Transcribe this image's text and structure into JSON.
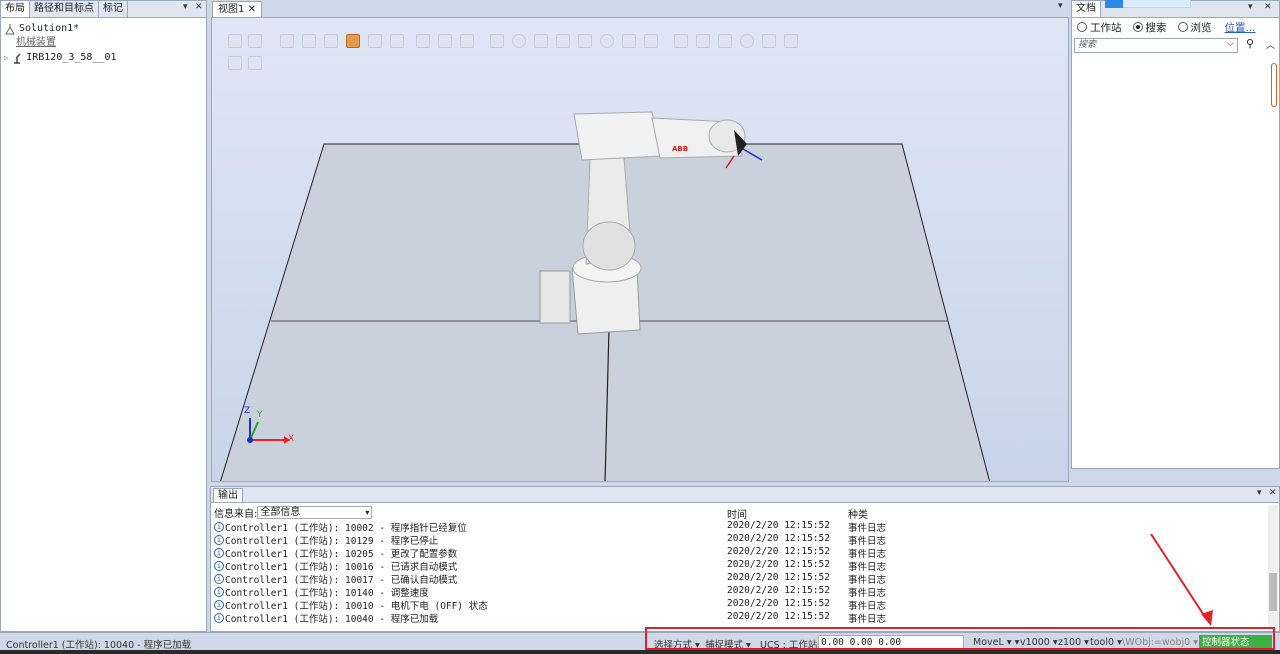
{
  "left_panel": {
    "tabs": [
      "布局",
      "路径和目标点",
      "标记"
    ],
    "tree": {
      "root": "Solution1*",
      "group": "机械装置",
      "item": "IRB120_3_58__01"
    }
  },
  "view": {
    "tab": "视图1",
    "robot_logo": "ABB",
    "axes": {
      "x": "X",
      "y": "Y",
      "z": "Z"
    }
  },
  "right_panel": {
    "tab": "文档",
    "radios": [
      {
        "label": "工作站",
        "selected": false
      },
      {
        "label": "搜索",
        "selected": true
      },
      {
        "label": "浏览",
        "selected": false
      }
    ],
    "location_link": "位置...",
    "search_placeholder": "搜索"
  },
  "output": {
    "tab": "输出",
    "filter_label": "信息来自:",
    "filter_value": "全部信息",
    "columns": {
      "time": "时间",
      "kind": "种类"
    },
    "rows": [
      {
        "msg": "Controller1 (工作站): 10002 - 程序指针已经复位",
        "time": "2020/2/20 12:15:52",
        "kind": "事件日志"
      },
      {
        "msg": "Controller1 (工作站): 10129 - 程序已停止",
        "time": "2020/2/20 12:15:52",
        "kind": "事件日志"
      },
      {
        "msg": "Controller1 (工作站): 10205 - 更改了配置参数",
        "time": "2020/2/20 12:15:52",
        "kind": "事件日志"
      },
      {
        "msg": "Controller1 (工作站): 10016 - 已请求自动模式",
        "time": "2020/2/20 12:15:52",
        "kind": "事件日志"
      },
      {
        "msg": "Controller1 (工作站): 10017 - 已确认自动模式",
        "time": "2020/2/20 12:15:52",
        "kind": "事件日志"
      },
      {
        "msg": "Controller1 (工作站): 10140 - 调整速度",
        "time": "2020/2/20 12:15:52",
        "kind": "事件日志"
      },
      {
        "msg": "Controller1 (工作站): 10010 - 电机下电 (OFF) 状态",
        "time": "2020/2/20 12:15:52",
        "kind": "事件日志"
      },
      {
        "msg": "Controller1 (工作站): 10040 - 程序已加载",
        "time": "2020/2/20 12:15:52",
        "kind": "事件日志"
      }
    ]
  },
  "status_bar": {
    "message": "Controller1 (工作站): 10040 - 程序已加载",
    "select_mode": "选择方式",
    "snap_mode": "捕捉模式",
    "ucs": "UCS : 工作站",
    "coords": "0.00   0.00   0.00",
    "move": "MoveL",
    "speed": "v1000",
    "zone": "z100",
    "tool": "tool0",
    "wobj": "\\WObj:=wobj0",
    "controller_status": "控制器状态"
  },
  "colors": {
    "highlight": "#e3202a",
    "status_green": "#3cb043",
    "accent": "#2b5fb3"
  }
}
